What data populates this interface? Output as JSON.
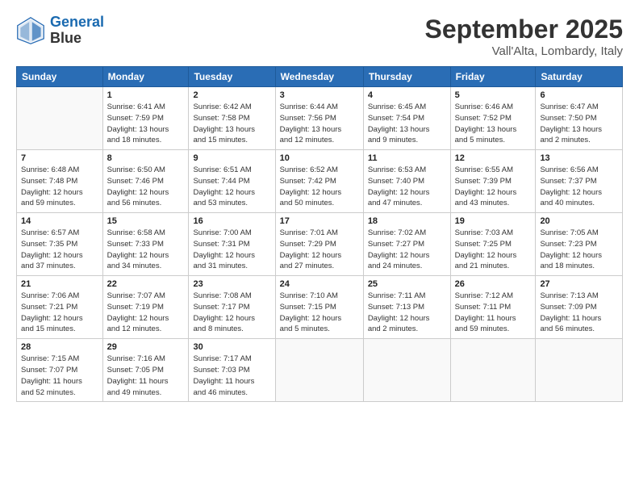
{
  "logo": {
    "line1": "General",
    "line2": "Blue"
  },
  "title": "September 2025",
  "subtitle": "Vall'Alta, Lombardy, Italy",
  "days_of_week": [
    "Sunday",
    "Monday",
    "Tuesday",
    "Wednesday",
    "Thursday",
    "Friday",
    "Saturday"
  ],
  "weeks": [
    [
      {
        "day": "",
        "info": ""
      },
      {
        "day": "1",
        "info": "Sunrise: 6:41 AM\nSunset: 7:59 PM\nDaylight: 13 hours\nand 18 minutes."
      },
      {
        "day": "2",
        "info": "Sunrise: 6:42 AM\nSunset: 7:58 PM\nDaylight: 13 hours\nand 15 minutes."
      },
      {
        "day": "3",
        "info": "Sunrise: 6:44 AM\nSunset: 7:56 PM\nDaylight: 13 hours\nand 12 minutes."
      },
      {
        "day": "4",
        "info": "Sunrise: 6:45 AM\nSunset: 7:54 PM\nDaylight: 13 hours\nand 9 minutes."
      },
      {
        "day": "5",
        "info": "Sunrise: 6:46 AM\nSunset: 7:52 PM\nDaylight: 13 hours\nand 5 minutes."
      },
      {
        "day": "6",
        "info": "Sunrise: 6:47 AM\nSunset: 7:50 PM\nDaylight: 13 hours\nand 2 minutes."
      }
    ],
    [
      {
        "day": "7",
        "info": "Sunrise: 6:48 AM\nSunset: 7:48 PM\nDaylight: 12 hours\nand 59 minutes."
      },
      {
        "day": "8",
        "info": "Sunrise: 6:50 AM\nSunset: 7:46 PM\nDaylight: 12 hours\nand 56 minutes."
      },
      {
        "day": "9",
        "info": "Sunrise: 6:51 AM\nSunset: 7:44 PM\nDaylight: 12 hours\nand 53 minutes."
      },
      {
        "day": "10",
        "info": "Sunrise: 6:52 AM\nSunset: 7:42 PM\nDaylight: 12 hours\nand 50 minutes."
      },
      {
        "day": "11",
        "info": "Sunrise: 6:53 AM\nSunset: 7:40 PM\nDaylight: 12 hours\nand 47 minutes."
      },
      {
        "day": "12",
        "info": "Sunrise: 6:55 AM\nSunset: 7:39 PM\nDaylight: 12 hours\nand 43 minutes."
      },
      {
        "day": "13",
        "info": "Sunrise: 6:56 AM\nSunset: 7:37 PM\nDaylight: 12 hours\nand 40 minutes."
      }
    ],
    [
      {
        "day": "14",
        "info": "Sunrise: 6:57 AM\nSunset: 7:35 PM\nDaylight: 12 hours\nand 37 minutes."
      },
      {
        "day": "15",
        "info": "Sunrise: 6:58 AM\nSunset: 7:33 PM\nDaylight: 12 hours\nand 34 minutes."
      },
      {
        "day": "16",
        "info": "Sunrise: 7:00 AM\nSunset: 7:31 PM\nDaylight: 12 hours\nand 31 minutes."
      },
      {
        "day": "17",
        "info": "Sunrise: 7:01 AM\nSunset: 7:29 PM\nDaylight: 12 hours\nand 27 minutes."
      },
      {
        "day": "18",
        "info": "Sunrise: 7:02 AM\nSunset: 7:27 PM\nDaylight: 12 hours\nand 24 minutes."
      },
      {
        "day": "19",
        "info": "Sunrise: 7:03 AM\nSunset: 7:25 PM\nDaylight: 12 hours\nand 21 minutes."
      },
      {
        "day": "20",
        "info": "Sunrise: 7:05 AM\nSunset: 7:23 PM\nDaylight: 12 hours\nand 18 minutes."
      }
    ],
    [
      {
        "day": "21",
        "info": "Sunrise: 7:06 AM\nSunset: 7:21 PM\nDaylight: 12 hours\nand 15 minutes."
      },
      {
        "day": "22",
        "info": "Sunrise: 7:07 AM\nSunset: 7:19 PM\nDaylight: 12 hours\nand 12 minutes."
      },
      {
        "day": "23",
        "info": "Sunrise: 7:08 AM\nSunset: 7:17 PM\nDaylight: 12 hours\nand 8 minutes."
      },
      {
        "day": "24",
        "info": "Sunrise: 7:10 AM\nSunset: 7:15 PM\nDaylight: 12 hours\nand 5 minutes."
      },
      {
        "day": "25",
        "info": "Sunrise: 7:11 AM\nSunset: 7:13 PM\nDaylight: 12 hours\nand 2 minutes."
      },
      {
        "day": "26",
        "info": "Sunrise: 7:12 AM\nSunset: 7:11 PM\nDaylight: 11 hours\nand 59 minutes."
      },
      {
        "day": "27",
        "info": "Sunrise: 7:13 AM\nSunset: 7:09 PM\nDaylight: 11 hours\nand 56 minutes."
      }
    ],
    [
      {
        "day": "28",
        "info": "Sunrise: 7:15 AM\nSunset: 7:07 PM\nDaylight: 11 hours\nand 52 minutes."
      },
      {
        "day": "29",
        "info": "Sunrise: 7:16 AM\nSunset: 7:05 PM\nDaylight: 11 hours\nand 49 minutes."
      },
      {
        "day": "30",
        "info": "Sunrise: 7:17 AM\nSunset: 7:03 PM\nDaylight: 11 hours\nand 46 minutes."
      },
      {
        "day": "",
        "info": ""
      },
      {
        "day": "",
        "info": ""
      },
      {
        "day": "",
        "info": ""
      },
      {
        "day": "",
        "info": ""
      }
    ]
  ]
}
